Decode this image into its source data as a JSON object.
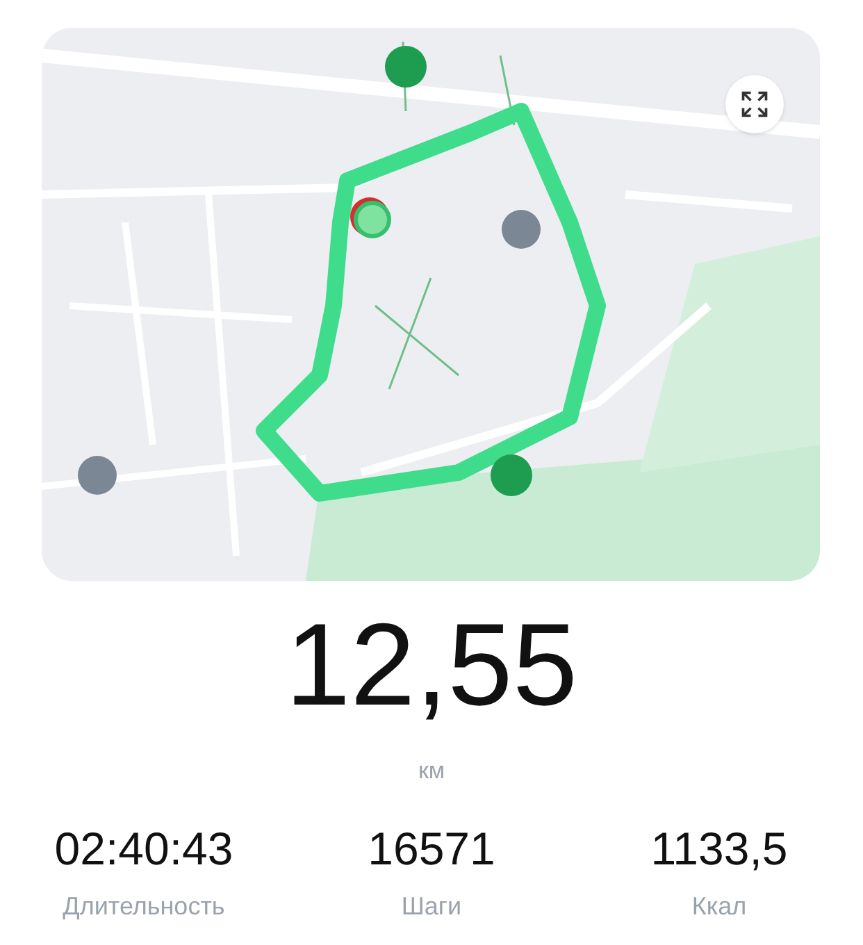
{
  "distance": {
    "value": "12,55",
    "unit": "км"
  },
  "stats": [
    {
      "value": "02:40:43",
      "label": "Длительность"
    },
    {
      "value": "16571",
      "label": "Шаги"
    },
    {
      "value": "1133,5",
      "label": "Ккал"
    }
  ]
}
